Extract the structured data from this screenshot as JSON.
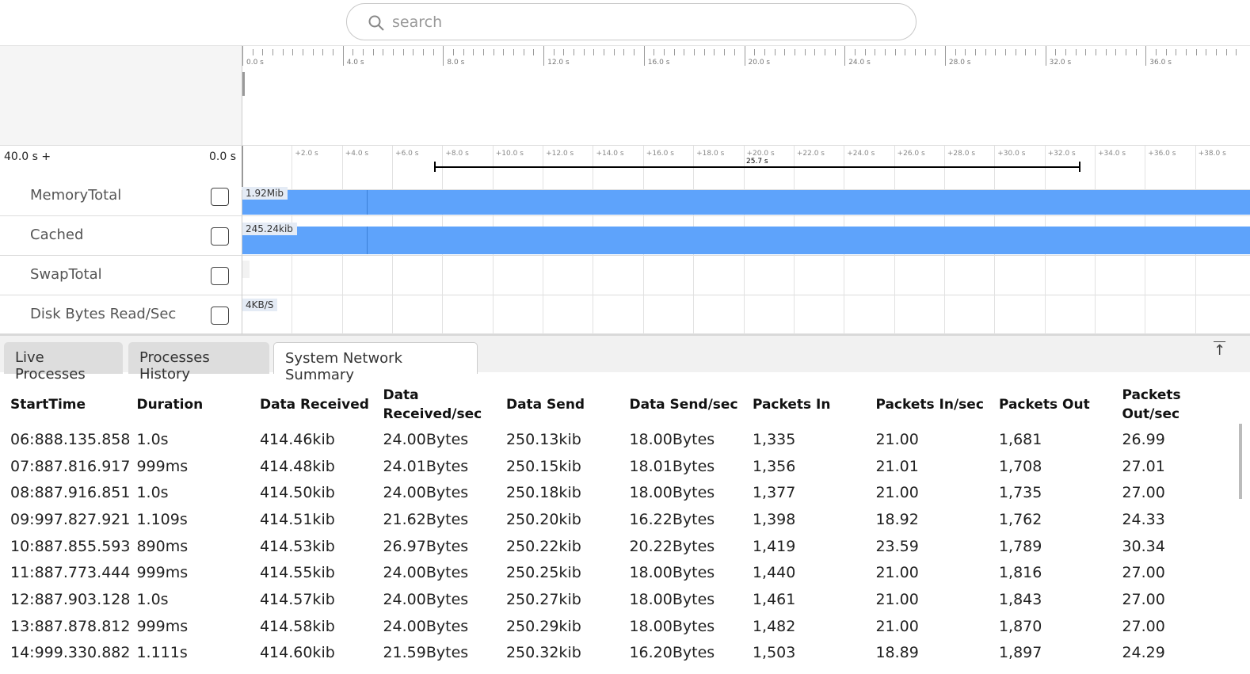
{
  "search": {
    "placeholder": "search"
  },
  "timeline": {
    "ruler_labels": [
      "0.0 s",
      "4.0 s",
      "8.0 s",
      "12.0 s",
      "16.0 s",
      "20.0 s",
      "24.0 s",
      "28.0 s",
      "32.0 s",
      "36.0 s"
    ],
    "range_labels": [
      "+2.0 s",
      "+4.0 s",
      "+6.0 s",
      "+8.0 s",
      "+10.0 s",
      "+12.0 s",
      "+14.0 s",
      "+16.0 s",
      "+18.0 s",
      "+20.0 s",
      "+22.0 s",
      "+24.0 s",
      "+26.0 s",
      "+28.0 s",
      "+30.0 s",
      "+32.0 s",
      "+34.0 s",
      "+36.0 s",
      "+38.0 s"
    ],
    "left_label": "40.0 s +",
    "right_label": "0.0 s",
    "selection": "25.7 s"
  },
  "tracks": [
    {
      "name": "MemoryTotal",
      "value": "1.92Mib"
    },
    {
      "name": "Cached",
      "value": "245.24kib"
    },
    {
      "name": "SwapTotal",
      "value": ""
    },
    {
      "name": "Disk Bytes Read/Sec",
      "value": "4KB/S"
    }
  ],
  "colors": {
    "bar": "#5ea3fb"
  },
  "tabs": [
    {
      "label": "Live Processes"
    },
    {
      "label": "Processes History"
    },
    {
      "label": "System Network Summary",
      "active": true
    }
  ],
  "table": {
    "headers": [
      "StartTime",
      "Duration",
      "Data Received",
      "Data Received/sec",
      "Data Send",
      "Data Send/sec",
      "Packets In",
      "Packets In/sec",
      "Packets Out",
      "Packets Out/sec"
    ],
    "rows": [
      [
        "06:888.135.858",
        "1.0s",
        "414.46kib",
        "24.00Bytes",
        "250.13kib",
        "18.00Bytes",
        "1,335",
        "21.00",
        "1,681",
        "26.99"
      ],
      [
        "07:887.816.917",
        "999ms",
        "414.48kib",
        "24.01Bytes",
        "250.15kib",
        "18.01Bytes",
        "1,356",
        "21.01",
        "1,708",
        "27.01"
      ],
      [
        "08:887.916.851",
        "1.0s",
        "414.50kib",
        "24.00Bytes",
        "250.18kib",
        "18.00Bytes",
        "1,377",
        "21.00",
        "1,735",
        "27.00"
      ],
      [
        "09:997.827.921",
        "1.109s",
        "414.51kib",
        "21.62Bytes",
        "250.20kib",
        "16.22Bytes",
        "1,398",
        "18.92",
        "1,762",
        "24.33"
      ],
      [
        "10:887.855.593",
        "890ms",
        "414.53kib",
        "26.97Bytes",
        "250.22kib",
        "20.22Bytes",
        "1,419",
        "23.59",
        "1,789",
        "30.34"
      ],
      [
        "11:887.773.444",
        "999ms",
        "414.55kib",
        "24.00Bytes",
        "250.25kib",
        "18.00Bytes",
        "1,440",
        "21.00",
        "1,816",
        "27.00"
      ],
      [
        "12:887.903.128",
        "1.0s",
        "414.57kib",
        "24.00Bytes",
        "250.27kib",
        "18.00Bytes",
        "1,461",
        "21.00",
        "1,843",
        "27.00"
      ],
      [
        "13:887.878.812",
        "999ms",
        "414.58kib",
        "24.00Bytes",
        "250.29kib",
        "18.00Bytes",
        "1,482",
        "21.00",
        "1,870",
        "27.00"
      ],
      [
        "14:999.330.882",
        "1.111s",
        "414.60kib",
        "21.59Bytes",
        "250.32kib",
        "16.20Bytes",
        "1,503",
        "18.89",
        "1,897",
        "24.29"
      ]
    ]
  }
}
